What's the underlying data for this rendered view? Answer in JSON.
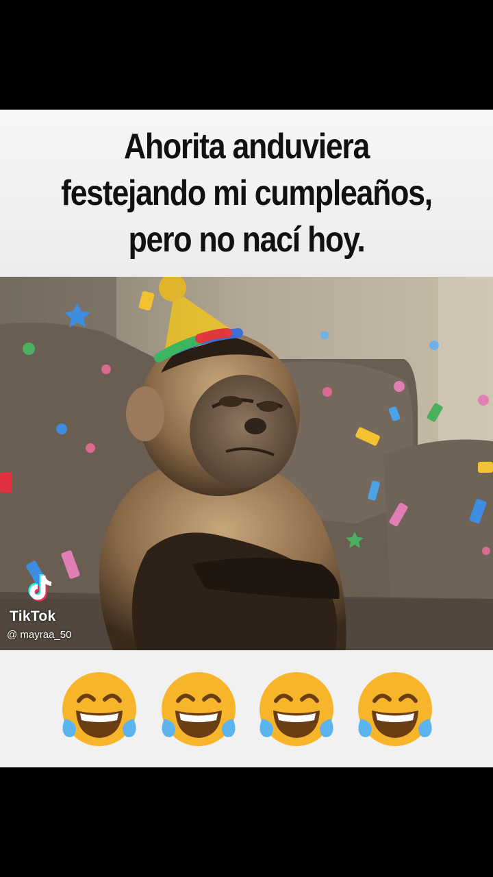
{
  "caption": {
    "text": "Ahorita anduviera\nfestejando mi cumpleaños,\npero no nací hoy."
  },
  "watermark": {
    "brand": "TikTok",
    "username": "@ mayraa_50",
    "icon": "tiktok-note-icon"
  },
  "emoji_row": {
    "icon": "face-with-tears-of-joy-icon",
    "count": 4
  },
  "colors": {
    "background": "#000000",
    "caption_bg": "#f2f2f2",
    "caption_text": "#111111",
    "emoji_yellow": "#f7b52c",
    "tiktok_cyan": "#25f4ee",
    "tiktok_red": "#fe2c55"
  }
}
